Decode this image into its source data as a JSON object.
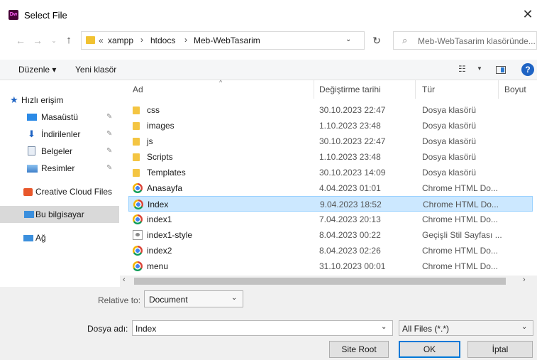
{
  "window": {
    "title": "Select File",
    "app_icon_text": "Dw"
  },
  "address": {
    "overflow": "«",
    "crumbs": [
      "xampp",
      "htdocs",
      "Meb-WebTasarim"
    ],
    "search_placeholder": "Meb-WebTasarim klasöründe..."
  },
  "toolbar": {
    "organize_label": "Düzenle ▾",
    "new_folder_label": "Yeni klasör"
  },
  "nav": {
    "quick_access": "Hızlı erişim",
    "items": [
      "Masaüstü",
      "İndirilenler",
      "Belgeler",
      "Resimler"
    ],
    "creative_cloud": "Creative Cloud Files",
    "this_pc": "Bu bilgisayar",
    "network": "Ağ"
  },
  "columns": {
    "name": "Ad",
    "date": "Değiştirme tarihi",
    "type": "Tür",
    "size": "Boyut"
  },
  "files": [
    {
      "name": "css",
      "date": "30.10.2023 22:47",
      "type": "Dosya klasörü",
      "icon": "folder-icon"
    },
    {
      "name": "images",
      "date": "1.10.2023 23:48",
      "type": "Dosya klasörü",
      "icon": "folder-icon"
    },
    {
      "name": "js",
      "date": "30.10.2023 22:47",
      "type": "Dosya klasörü",
      "icon": "folder-icon"
    },
    {
      "name": "Scripts",
      "date": "1.10.2023 23:48",
      "type": "Dosya klasörü",
      "icon": "folder-icon"
    },
    {
      "name": "Templates",
      "date": "30.10.2023 14:09",
      "type": "Dosya klasörü",
      "icon": "folder-icon"
    },
    {
      "name": "Anasayfa",
      "date": "4.04.2023 01:01",
      "type": "Chrome HTML Do...",
      "icon": "chrome-icon"
    },
    {
      "name": "Index",
      "date": "9.04.2023 18:52",
      "type": "Chrome HTML Do...",
      "icon": "chrome-icon",
      "selected": true
    },
    {
      "name": "index1",
      "date": "7.04.2023 20:13",
      "type": "Chrome HTML Do...",
      "icon": "chrome-icon"
    },
    {
      "name": "index1-style",
      "date": "8.04.2023 00:22",
      "type": "Geçişli Stil Sayfası ...",
      "icon": "css-file-icon"
    },
    {
      "name": "index2",
      "date": "8.04.2023 02:26",
      "type": "Chrome HTML Do...",
      "icon": "chrome-icon"
    },
    {
      "name": "menu",
      "date": "31.10.2023 00:01",
      "type": "Chrome HTML Do...",
      "icon": "chrome-icon"
    }
  ],
  "bottom": {
    "relative_label": "Relative to:",
    "relative_value": "Document",
    "filename_label": "Dosya adı:",
    "filename_value": "Index",
    "filetype_value": "All Files (*.*)",
    "site_root_label": "Site Root",
    "ok_label": "OK",
    "cancel_label": "İptal"
  }
}
